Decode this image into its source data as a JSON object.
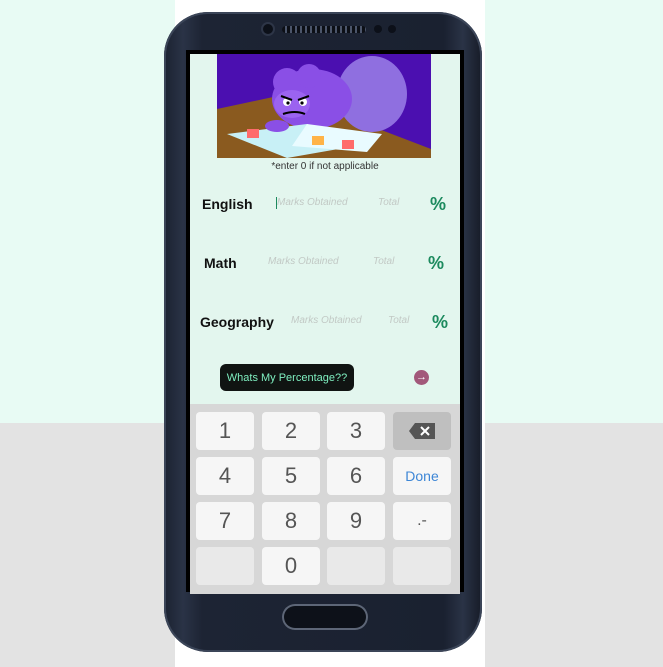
{
  "app": {
    "caption": "*enter 0 if not applicable",
    "subjects": [
      {
        "label": "English",
        "marks_placeholder": "Marks Obtained",
        "total_placeholder": "Total",
        "percent_symbol": "%"
      },
      {
        "label": "Math",
        "marks_placeholder": "Marks Obtained",
        "total_placeholder": "Total",
        "percent_symbol": "%"
      },
      {
        "label": "Geography",
        "marks_placeholder": "Marks Obtained",
        "total_placeholder": "Total",
        "percent_symbol": "%"
      }
    ],
    "calculate_button": "Whats My Percentage??",
    "arrow_icon": "arrow-right-icon"
  },
  "keypad": {
    "keys": [
      "1",
      "2",
      "3",
      "4",
      "5",
      "6",
      "7",
      "8",
      "9",
      "0"
    ],
    "backspace_icon": "backspace-icon",
    "done_label": "Done",
    "dot_minus": ".-"
  },
  "colors": {
    "accent": "#1c8a5e",
    "button_bg": "#101412",
    "button_text": "#7ff0c1",
    "screen_bg": "#e3f6ee",
    "banner_bg": "#4b0fb0"
  }
}
